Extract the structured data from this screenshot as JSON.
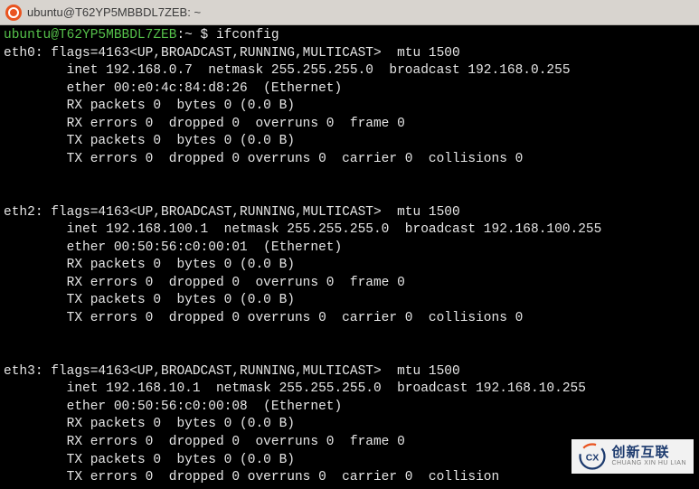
{
  "window": {
    "title": "ubuntu@T62YP5MBBDL7ZEB: ~"
  },
  "prompt": {
    "user": "ubuntu@T62YP5MBBDL7ZEB",
    "sep": ":",
    "path": "~",
    "symbol": "$",
    "command": "ifconfig"
  },
  "interfaces": [
    {
      "name": "eth0",
      "flags_line": "flags=4163<UP,BROADCAST,RUNNING,MULTICAST>  mtu 1500",
      "inet_line": "inet 192.168.0.7  netmask 255.255.255.0  broadcast 192.168.0.255",
      "ether_line": "ether 00:e0:4c:84:d8:26  (Ethernet)",
      "rx_packets": "RX packets 0  bytes 0 (0.0 B)",
      "rx_errors": "RX errors 0  dropped 0  overruns 0  frame 0",
      "tx_packets": "TX packets 0  bytes 0 (0.0 B)",
      "tx_errors": "TX errors 0  dropped 0 overruns 0  carrier 0  collisions 0"
    },
    {
      "name": "eth2",
      "flags_line": "flags=4163<UP,BROADCAST,RUNNING,MULTICAST>  mtu 1500",
      "inet_line": "inet 192.168.100.1  netmask 255.255.255.0  broadcast 192.168.100.255",
      "ether_line": "ether 00:50:56:c0:00:01  (Ethernet)",
      "rx_packets": "RX packets 0  bytes 0 (0.0 B)",
      "rx_errors": "RX errors 0  dropped 0  overruns 0  frame 0",
      "tx_packets": "TX packets 0  bytes 0 (0.0 B)",
      "tx_errors": "TX errors 0  dropped 0 overruns 0  carrier 0  collisions 0"
    },
    {
      "name": "eth3",
      "flags_line": "flags=4163<UP,BROADCAST,RUNNING,MULTICAST>  mtu 1500",
      "inet_line": "inet 192.168.10.1  netmask 255.255.255.0  broadcast 192.168.10.255",
      "ether_line": "ether 00:50:56:c0:00:08  (Ethernet)",
      "rx_packets": "RX packets 0  bytes 0 (0.0 B)",
      "rx_errors": "RX errors 0  dropped 0  overruns 0  frame 0",
      "tx_packets": "TX packets 0  bytes 0 (0.0 B)",
      "tx_errors": "TX errors 0  dropped 0 overruns 0  carrier 0  collision"
    }
  ],
  "watermark": {
    "big": "创新互联",
    "small": "CHUANG XIN HU LIAN"
  }
}
